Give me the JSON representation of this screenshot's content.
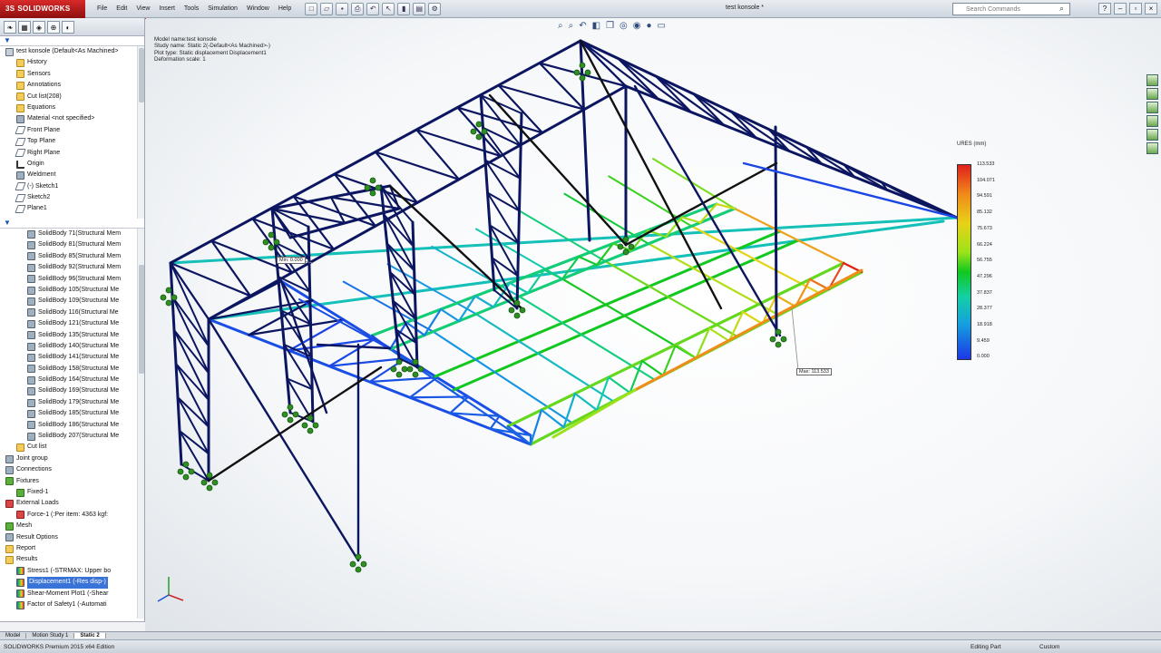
{
  "app": {
    "name": "SOLIDWORKS",
    "doc_title": "test konsole *"
  },
  "menu": [
    "File",
    "Edit",
    "View",
    "Insert",
    "Tools",
    "Simulation",
    "Window",
    "Help"
  ],
  "search": {
    "placeholder": "Search Commands"
  },
  "feature_tree": {
    "items": [
      {
        "label": "test konsole  (Default<As Machined>",
        "icon": "part-icon",
        "indent": 0
      },
      {
        "label": "History",
        "icon": "folder-icon",
        "indent": 1
      },
      {
        "label": "Sensors",
        "icon": "folder-icon",
        "indent": 1
      },
      {
        "label": "Annotations",
        "icon": "folder-icon",
        "indent": 1
      },
      {
        "label": "Cut list(208)",
        "icon": "folder-icon",
        "indent": 1
      },
      {
        "label": "Equations",
        "icon": "folder-icon",
        "indent": 1
      },
      {
        "label": "Material <not specified>",
        "icon": "body-icon",
        "indent": 1
      },
      {
        "label": "Front Plane",
        "icon": "plane-icon",
        "indent": 1
      },
      {
        "label": "Top Plane",
        "icon": "plane-icon",
        "indent": 1
      },
      {
        "label": "Right Plane",
        "icon": "plane-icon",
        "indent": 1
      },
      {
        "label": "Origin",
        "icon": "origin-icon",
        "indent": 1
      },
      {
        "label": "Weldment",
        "icon": "body-icon",
        "indent": 1
      },
      {
        "label": "(-) Sketch1",
        "icon": "plane-icon",
        "indent": 1
      },
      {
        "label": "Sketch2",
        "icon": "plane-icon",
        "indent": 1
      },
      {
        "label": "Plane1",
        "icon": "plane-icon",
        "indent": 1
      }
    ]
  },
  "sim_tree": {
    "items": [
      {
        "label": "SolidBody 71(Structural Mem",
        "icon": "body-icon",
        "indent": 2
      },
      {
        "label": "SolidBody 81(Structural Mem",
        "icon": "body-icon",
        "indent": 2
      },
      {
        "label": "SolidBody 85(Structural Mem",
        "icon": "body-icon",
        "indent": 2
      },
      {
        "label": "SolidBody 92(Structural Mem",
        "icon": "body-icon",
        "indent": 2
      },
      {
        "label": "SolidBody 96(Structural Mem",
        "icon": "body-icon",
        "indent": 2
      },
      {
        "label": "SolidBody 105(Structural Me",
        "icon": "body-icon",
        "indent": 2
      },
      {
        "label": "SolidBody 109(Structural Me",
        "icon": "body-icon",
        "indent": 2
      },
      {
        "label": "SolidBody 116(Structural Me",
        "icon": "body-icon",
        "indent": 2
      },
      {
        "label": "SolidBody 121(Structural Me",
        "icon": "body-icon",
        "indent": 2
      },
      {
        "label": "SolidBody 135(Structural Me",
        "icon": "body-icon",
        "indent": 2
      },
      {
        "label": "SolidBody 140(Structural Me",
        "icon": "body-icon",
        "indent": 2
      },
      {
        "label": "SolidBody 141(Structural Me",
        "icon": "body-icon",
        "indent": 2
      },
      {
        "label": "SolidBody 158(Structural Me",
        "icon": "body-icon",
        "indent": 2
      },
      {
        "label": "SolidBody 164(Structural Me",
        "icon": "body-icon",
        "indent": 2
      },
      {
        "label": "SolidBody 169(Structural Me",
        "icon": "body-icon",
        "indent": 2
      },
      {
        "label": "SolidBody 179(Structural Me",
        "icon": "body-icon",
        "indent": 2
      },
      {
        "label": "SolidBody 185(Structural Me",
        "icon": "body-icon",
        "indent": 2
      },
      {
        "label": "SolidBody 186(Structural Me",
        "icon": "body-icon",
        "indent": 2
      },
      {
        "label": "SolidBody 207(Structural Me",
        "icon": "body-icon",
        "indent": 2
      },
      {
        "label": "Cut list",
        "icon": "folder-icon",
        "indent": 1
      },
      {
        "label": "Joint group",
        "icon": "body-icon",
        "indent": 0
      },
      {
        "label": "Connections",
        "icon": "body-icon",
        "indent": 0
      },
      {
        "label": "Fixtures",
        "icon": "green-icon",
        "indent": 0
      },
      {
        "label": "Fixed-1",
        "icon": "green-icon",
        "indent": 1
      },
      {
        "label": "External Loads",
        "icon": "red-icon",
        "indent": 0
      },
      {
        "label": "Force-1 (:Per item: 4363 kgf:",
        "icon": "red-icon",
        "indent": 1
      },
      {
        "label": "Mesh",
        "icon": "green-icon",
        "indent": 0
      },
      {
        "label": "Result Options",
        "icon": "body-icon",
        "indent": 0
      },
      {
        "label": "Report",
        "icon": "folder-icon",
        "indent": 0
      },
      {
        "label": "Results",
        "icon": "folder-icon",
        "indent": 0
      },
      {
        "label": "Stress1 (-STRMAX: Upper bo",
        "icon": "multi-icon",
        "indent": 1
      },
      {
        "label": "Displacement1 (-Res disp-)",
        "icon": "multi-icon",
        "indent": 1,
        "selected": true
      },
      {
        "label": "Shear-Moment Plot1 (-Shear",
        "icon": "multi-icon",
        "indent": 1
      },
      {
        "label": "Factor of Safety1 (-Automati",
        "icon": "multi-icon",
        "indent": 1
      }
    ]
  },
  "study_info": [
    "Model name:test konsole",
    "Study name: Static 2(-Default<As Machined>-)",
    "Plot type: Static displacement Displacement1",
    "Deformation scale: 1"
  ],
  "legend": {
    "title": "URES (mm)",
    "values": [
      "113.533",
      "104.071",
      "94.591",
      "85.132",
      "75.673",
      "66.224",
      "56.755",
      "47.296",
      "37.837",
      "28.377",
      "18.918",
      "9.459",
      "0.000"
    ]
  },
  "probes": {
    "min": "Min: 0.000",
    "max": "Max: 113.533"
  },
  "tabs": [
    "Model",
    "Motion Study 1",
    "Static 2"
  ],
  "status": {
    "left": "SOLIDWORKS Premium 2015 x64 Edition",
    "mode": "Editing Part",
    "units": "Custom"
  }
}
